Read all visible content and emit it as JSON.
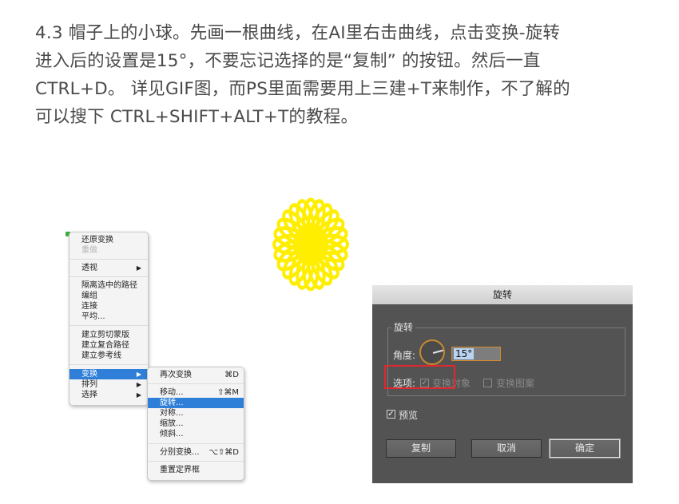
{
  "article": {
    "lines": [
      "4.3  帽子上的小球。先画一根曲线，在AI里右击曲线，点击变换-旋转",
      "进入后的设置是15°，不要忘记选择的是“复制” 的按钮。然后一直",
      "CTRL+D。 详见GIF图，而PS里面需要用上三建+T来制作，不了解的",
      "可以搜下 CTRL+SHIFT+ALT+T的教程。"
    ]
  },
  "context_menu": {
    "items": [
      {
        "label": "还原变换"
      },
      {
        "label": "重做"
      },
      {
        "label": "透视"
      },
      {
        "label": "隔离选中的路径"
      },
      {
        "label": "编组"
      },
      {
        "label": "连接"
      },
      {
        "label": "平均..."
      },
      {
        "label": "建立剪切蒙版"
      },
      {
        "label": "建立复合路径"
      },
      {
        "label": "建立参考线"
      },
      {
        "label": "变换"
      },
      {
        "label": "排列"
      },
      {
        "label": "选择"
      }
    ]
  },
  "submenu": {
    "items": [
      {
        "label": "再次变换",
        "shortcut": "⌘D"
      },
      {
        "label": "移动...",
        "shortcut": "⇧⌘M"
      },
      {
        "label": "旋转...",
        "shortcut": ""
      },
      {
        "label": "对称...",
        "shortcut": ""
      },
      {
        "label": "缩放...",
        "shortcut": ""
      },
      {
        "label": "倾斜...",
        "shortcut": ""
      },
      {
        "label": "分别变换...",
        "shortcut": "⌥⇧⌘D"
      },
      {
        "label": "重置定界框",
        "shortcut": ""
      }
    ]
  },
  "dialog": {
    "title": "旋转",
    "group_label": "旋转",
    "angle_label": "角度:",
    "angle_value": "15°",
    "options_label": "选项:",
    "transform_objects": "变换对象",
    "transform_pattern": "变换图案",
    "preview": "预览",
    "copy": "复制",
    "cancel": "取消",
    "ok": "确定"
  },
  "colors": {
    "sun": "#ffee00",
    "highlight": "#2f7fd8",
    "red_box": "#e0282e"
  }
}
